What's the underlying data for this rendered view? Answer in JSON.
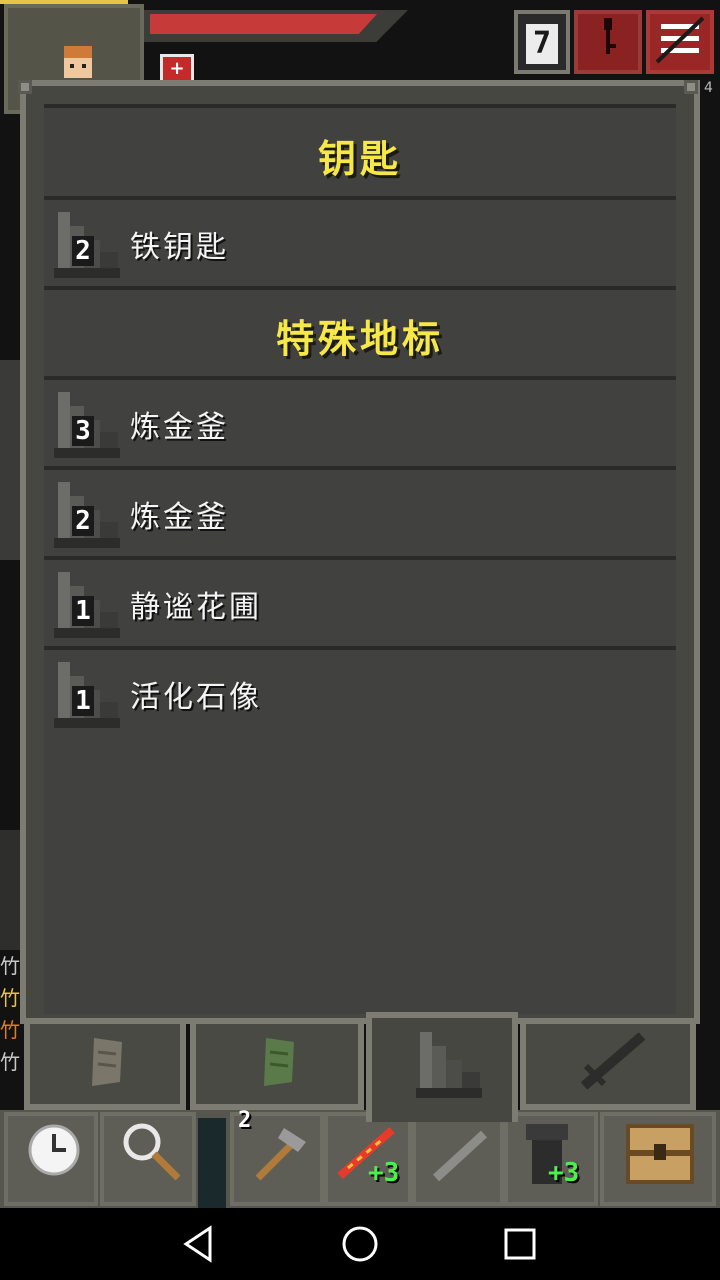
{
  "hud": {
    "depth": "7",
    "journal_icon": "key-icon",
    "menu_icon": "menu-icon",
    "buff_icon": "+",
    "corner_number": "4",
    "hp_fraction": 0.88
  },
  "journal": {
    "keys_title": "钥匙",
    "keys": [
      {
        "depth": "2",
        "label": "铁钥匙"
      }
    ],
    "landmarks_title": "特殊地标",
    "landmarks": [
      {
        "depth": "3",
        "label": "炼金釜"
      },
      {
        "depth": "2",
        "label": "炼金釜"
      },
      {
        "depth": "1",
        "label": "静谧花圃"
      },
      {
        "depth": "1",
        "label": "活化石像"
      }
    ]
  },
  "tabs": [
    {
      "name": "scroll-tab",
      "icon": "scroll-icon"
    },
    {
      "name": "notes-tab",
      "icon": "green-scroll-icon"
    },
    {
      "name": "landmarks-tab",
      "icon": "stairs-icon",
      "active": true
    },
    {
      "name": "items-tab",
      "icon": "dagger-icon"
    }
  ],
  "side_log": [
    "竹",
    "竹",
    "竹",
    "竹"
  ],
  "toolbar": {
    "quickslot_1_qty": "2",
    "quickslot_2_bonus": "+3",
    "quickslot_4_bonus": "+3"
  },
  "colors": {
    "title": "#f6e848",
    "hp": "#c73a3a",
    "bonus": "#4cf04c"
  }
}
